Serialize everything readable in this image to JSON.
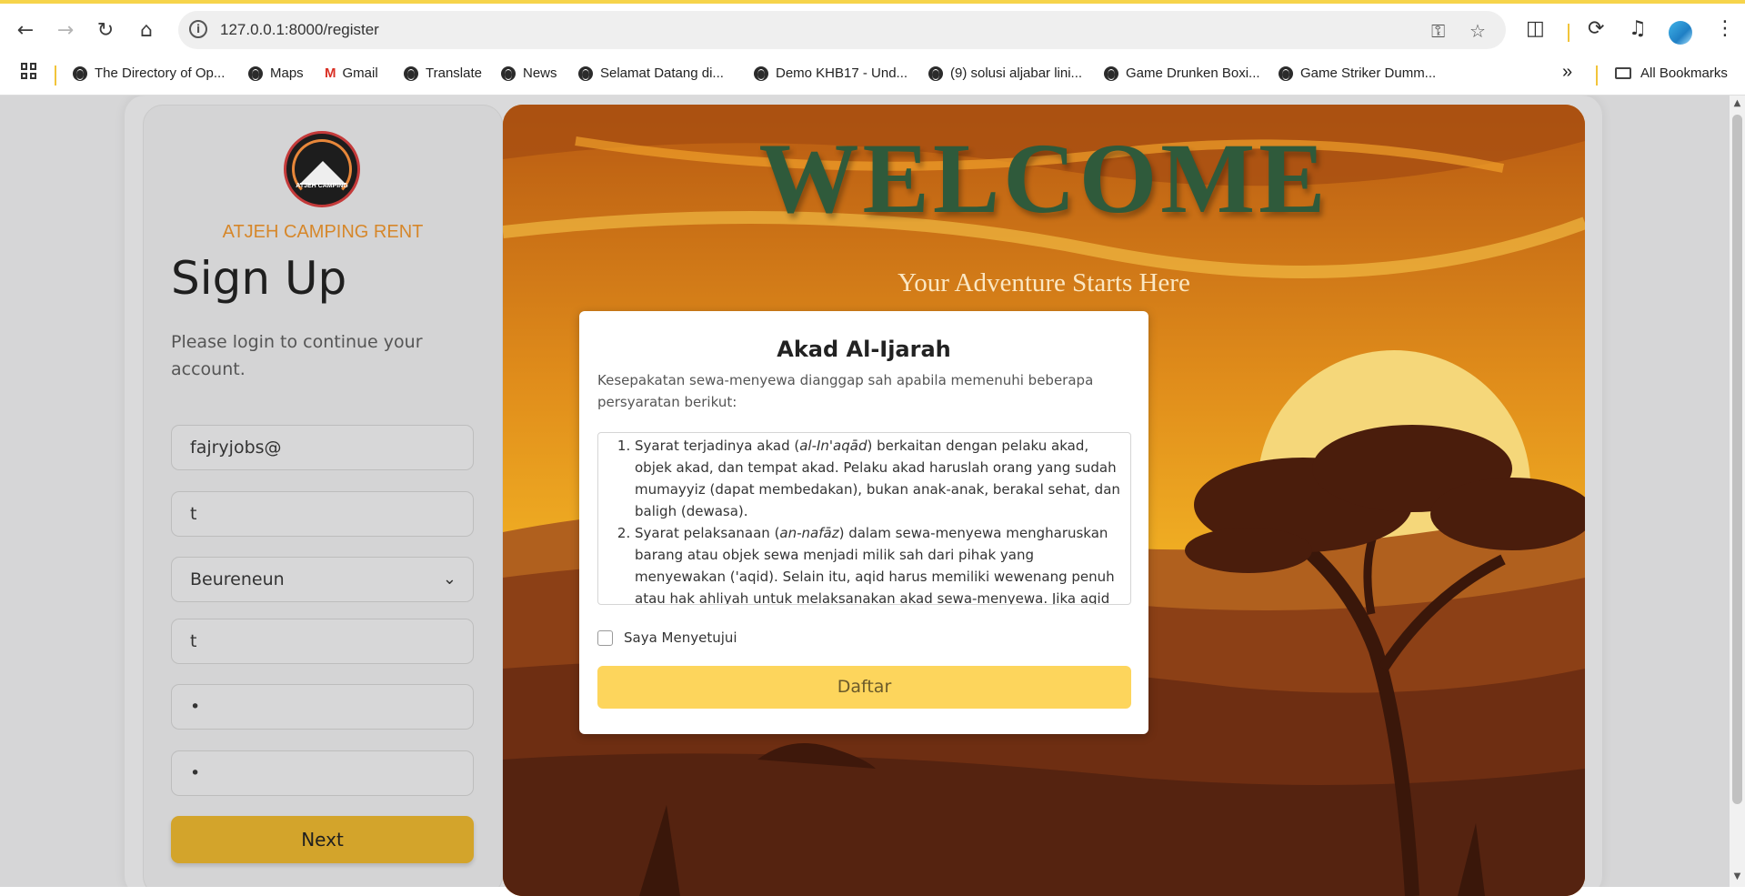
{
  "browser": {
    "url": "127.0.0.1:8000/register",
    "bookmarks": [
      "The Directory of Op...",
      "Maps",
      "Gmail",
      "Translate",
      "News",
      "Selamat Datang di...",
      "Demo KHB17 - Und...",
      "(9) solusi aljabar lini...",
      "Game Drunken Boxi...",
      "Game Striker Dumm..."
    ],
    "overflow": "»",
    "all_bookmarks": "All Bookmarks"
  },
  "signup": {
    "brand": "ATJEH CAMPING RENT",
    "logo_text": "ATJEH CAMPING",
    "title": "Sign Up",
    "subtitle": "Please login to continue your account.",
    "fields": {
      "email": "fajryjobs@",
      "name": "t",
      "location": "Beureneun",
      "phone": "t",
      "password": "•",
      "confirm_password": "•"
    },
    "next_label": "Next"
  },
  "hero": {
    "welcome": "WELCOME",
    "tagline": "Your Adventure Starts Here"
  },
  "modal": {
    "title": "Akad Al-Ijarah",
    "intro": "Kesepakatan sewa-menyewa dianggap sah apabila memenuhi beberapa persyaratan berikut:",
    "terms": [
      {
        "pre": "Syarat terjadinya akad (",
        "em": "al-In'aqād",
        "post": ") berkaitan dengan pelaku akad, objek akad, dan tempat akad. Pelaku akad haruslah orang yang sudah mumayyiz (dapat membedakan), bukan anak-anak, berakal sehat, dan baligh (dewasa)."
      },
      {
        "pre": "Syarat pelaksanaan (",
        "em": "an-nafāz",
        "post": ") dalam sewa-menyewa mengharuskan barang atau objek sewa menjadi milik sah dari pihak yang menyewakan ('aqid). Selain itu, aqid harus memiliki wewenang penuh atau hak ahliyah untuk melaksanakan akad sewa-menyewa. Jika aqid tidak memenuhi..."
      }
    ],
    "agree_label": "Saya Menyetujui",
    "agree_checked": false,
    "submit_label": "Daftar"
  },
  "colors": {
    "accent": "#d3a42b",
    "brand": "#d6872a",
    "welcome": "#2f5a3b",
    "submit": "#fdd55c"
  }
}
